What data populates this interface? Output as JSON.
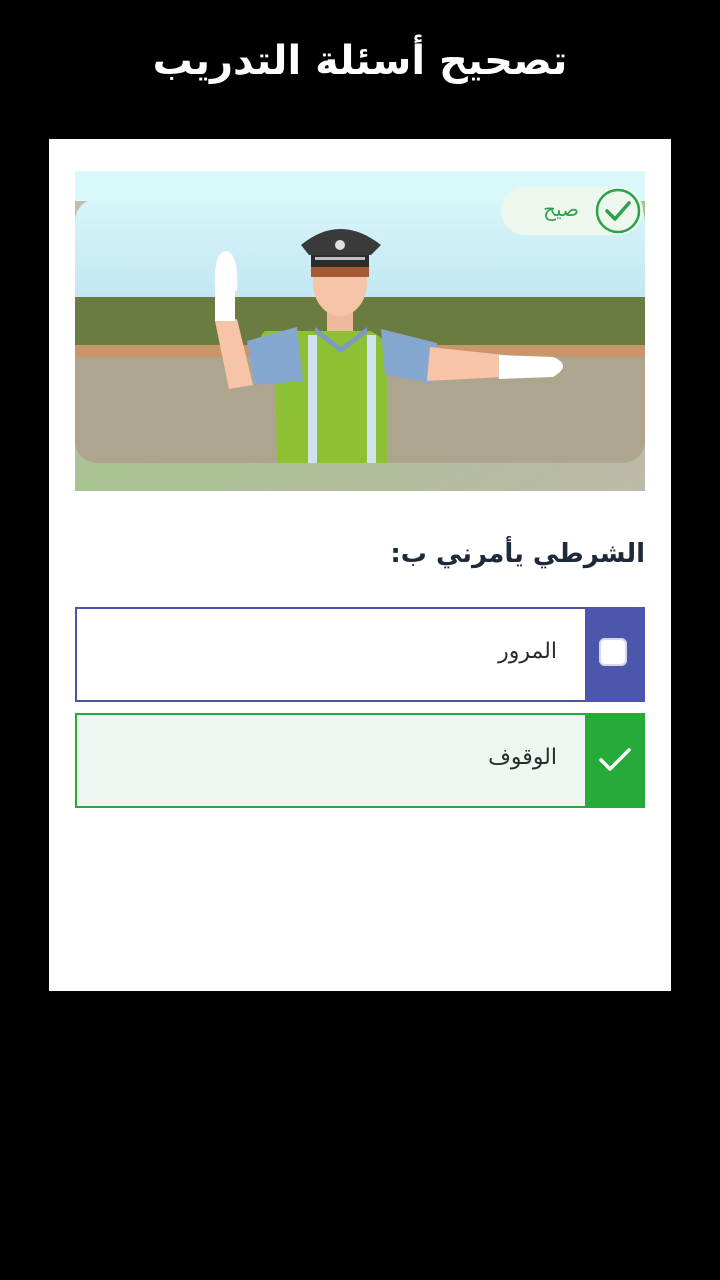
{
  "header": {
    "title": "تصحيح أسئلة التدريب"
  },
  "illustration": {
    "subject": "traffic-police-officer"
  },
  "result_badge": {
    "label": "صيح",
    "icon": "check-circle-icon",
    "color": "#2aa24a"
  },
  "question": {
    "text": "الشرطي يأمرني ب:"
  },
  "options": [
    {
      "label": "المرور",
      "state": "unchecked",
      "icon": "checkbox-icon",
      "accent": "#4d56ad"
    },
    {
      "label": "الوقوف",
      "state": "correct",
      "icon": "checkmark-icon",
      "accent": "#26aa3a"
    }
  ]
}
